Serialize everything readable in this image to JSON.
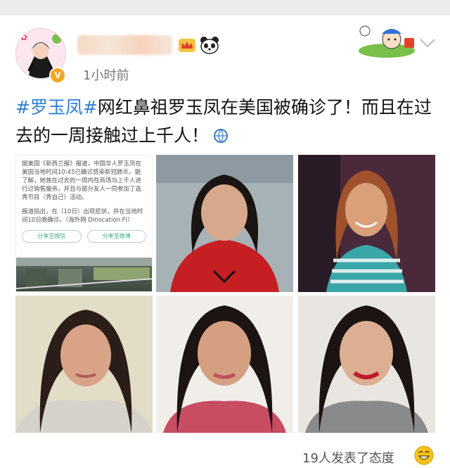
{
  "post": {
    "time": "1小时前",
    "hashtag": "#罗玉凤#",
    "text": "网红鼻祖罗玉凤在美国被确诊了！而且在过去的一周接触过上千人！"
  },
  "news_card": {
    "paragraph1": "据美国《新西兰报》报道，中国华人罗玉凤在美国当地时间10:45已确诊感染新冠肺炎。据了解，她曾在过去的一周内在商场与上千人进行过销售服务，并且与部分友人一同参加了选秀节目（秀自己）活动。",
    "paragraph2": "报道指出，在（10日）出现症状，并在当地时间10日晚确诊。（海外网 Dinocation.FI）",
    "button1": "分享至微信",
    "button2": "分享至微博"
  },
  "footer": {
    "reactions": "19人发表了态度"
  },
  "colors": {
    "hashtag": "#2e7fd6",
    "verify_badge": "#f5a623",
    "background": "#ffffff"
  },
  "icons": [
    "avatar-cartoon",
    "verified-badge-icon",
    "crown-icon",
    "panda-icon",
    "sticker-icon",
    "chevron-down-icon",
    "globe-icon",
    "smile-icon"
  ]
}
